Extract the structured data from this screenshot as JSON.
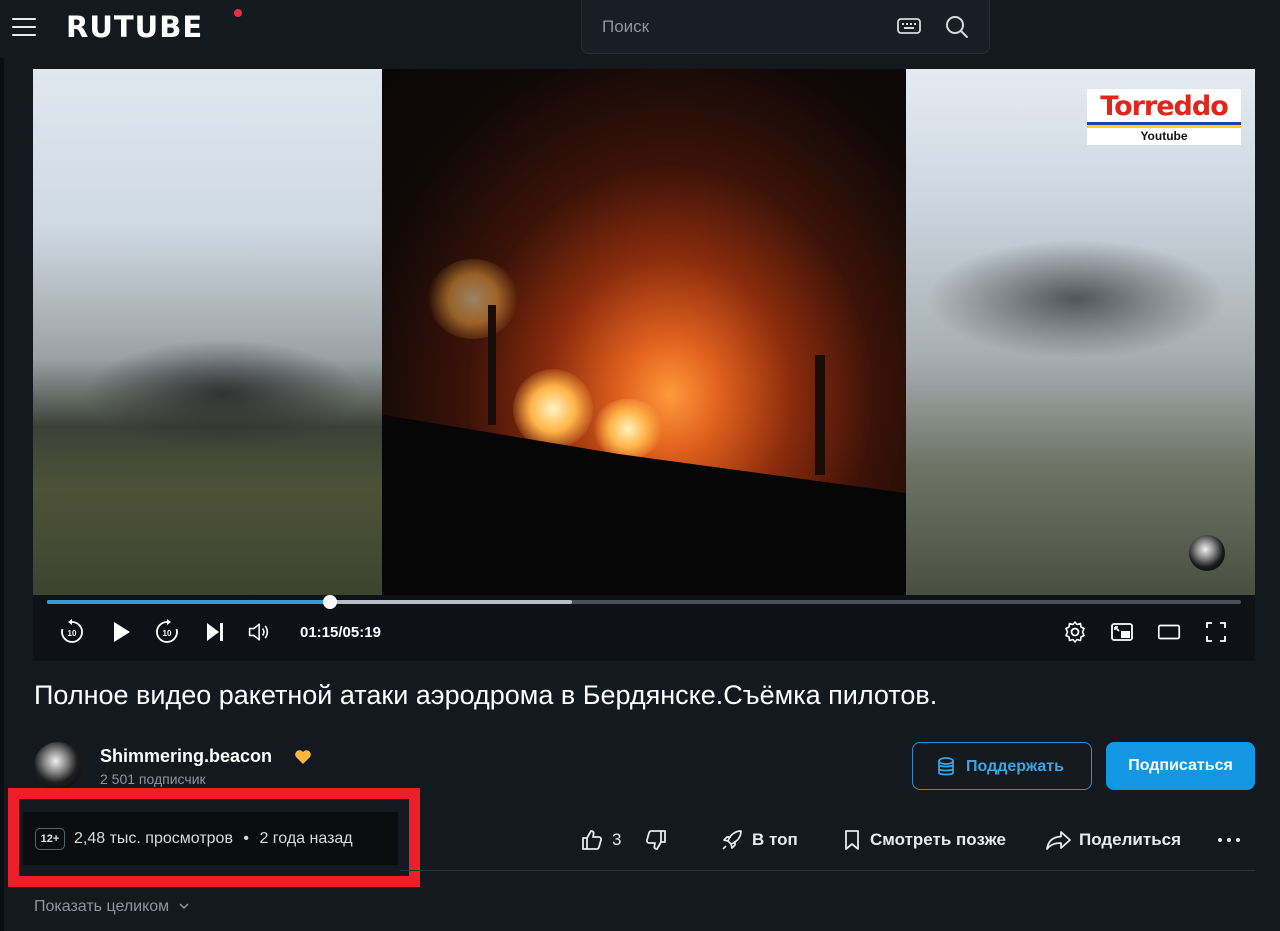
{
  "header": {
    "logo": "RUTUBE",
    "search_placeholder": "Поиск"
  },
  "player": {
    "watermark_title": "Torreddo",
    "watermark_subtitle": "Youtube",
    "time_current": "01:15",
    "time_total": "05:19",
    "progress_played": 0.237,
    "progress_buffered": 0.44
  },
  "video": {
    "title": "Полное видео ракетной атаки аэродрома в Бердянске.Съёмка пилотов.",
    "channel_name": "Shimmering.beacon",
    "subscribers": "2 501 подписчик",
    "support_label": "Поддержать",
    "subscribe_label": "Подписаться",
    "age_rating": "12+",
    "views": "2,48 тыс. просмотров",
    "separator": "•",
    "published": "2 года назад",
    "likes": "3",
    "top_label": "В топ",
    "watch_later_label": "Смотреть позже",
    "share_label": "Поделиться",
    "show_all_label": "Показать целиком"
  },
  "colors": {
    "background": "#14191f",
    "accent": "#1497e3",
    "progress": "#2d9cdb",
    "highlight_box": "#ec1f28"
  }
}
